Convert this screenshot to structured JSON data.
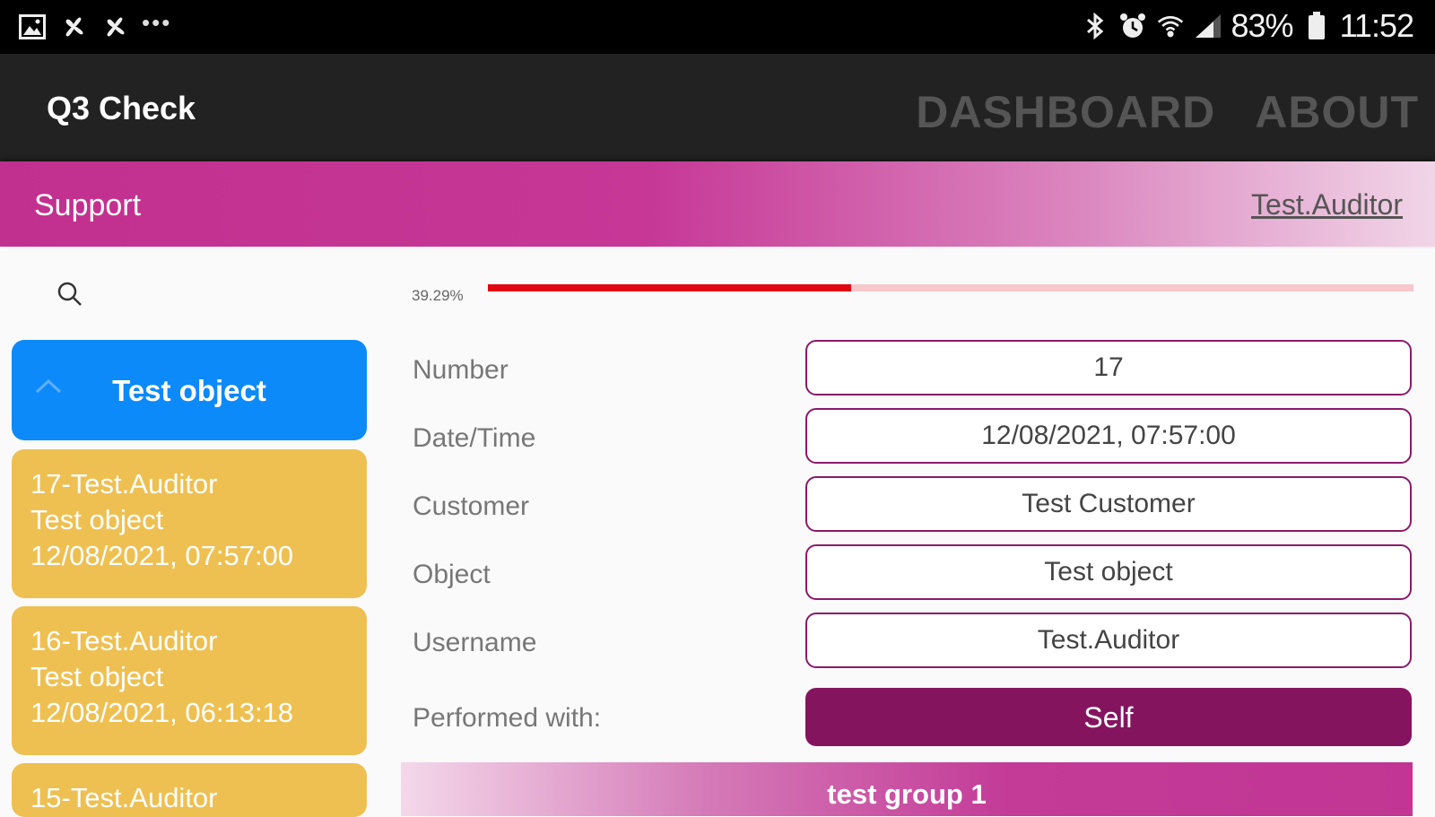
{
  "status_bar": {
    "battery": "83%",
    "time": "11:52",
    "left_icons": [
      "image-icon",
      "pinwheel-icon",
      "pinwheel-icon",
      "more-dots-icon"
    ],
    "right_icons": [
      "bluetooth-icon",
      "alarm-icon",
      "wifi-icon",
      "signal-icon",
      "battery-icon"
    ]
  },
  "app_bar": {
    "title": "Q3 Check",
    "nav": [
      {
        "label": "DASHBOARD"
      },
      {
        "label": "ABOUT"
      }
    ]
  },
  "support_bar": {
    "label": "Support",
    "user": "Test.Auditor"
  },
  "sidebar": {
    "search_icon": "search-icon",
    "group": {
      "title": "Test object",
      "icon": "chevron-up-icon"
    },
    "items": [
      {
        "line1": "17-Test.Auditor",
        "line2": "Test object",
        "line3": "12/08/2021, 07:57:00"
      },
      {
        "line1": "16-Test.Auditor",
        "line2": "Test object",
        "line3": "12/08/2021, 06:13:18"
      },
      {
        "line1": "15-Test.Auditor"
      }
    ]
  },
  "progress": {
    "label": "39.29%",
    "value_percent": 39.29
  },
  "form": {
    "fields": [
      {
        "label": "Number",
        "value": "17"
      },
      {
        "label": "Date/Time",
        "value": "12/08/2021, 07:57:00"
      },
      {
        "label": "Customer",
        "value": "Test Customer"
      },
      {
        "label": "Object",
        "value": "Test object"
      },
      {
        "label": "Username",
        "value": "Test.Auditor"
      }
    ],
    "performed_with": {
      "label": "Performed with:",
      "value": "Self"
    }
  },
  "group_bar": {
    "label": "test group 1"
  },
  "colors": {
    "accent_blue": "#0d8af9",
    "card_yellow": "#eec052",
    "magenta": "#c2308f",
    "dark_purple": "#85145f",
    "progress_red": "#e10713"
  }
}
